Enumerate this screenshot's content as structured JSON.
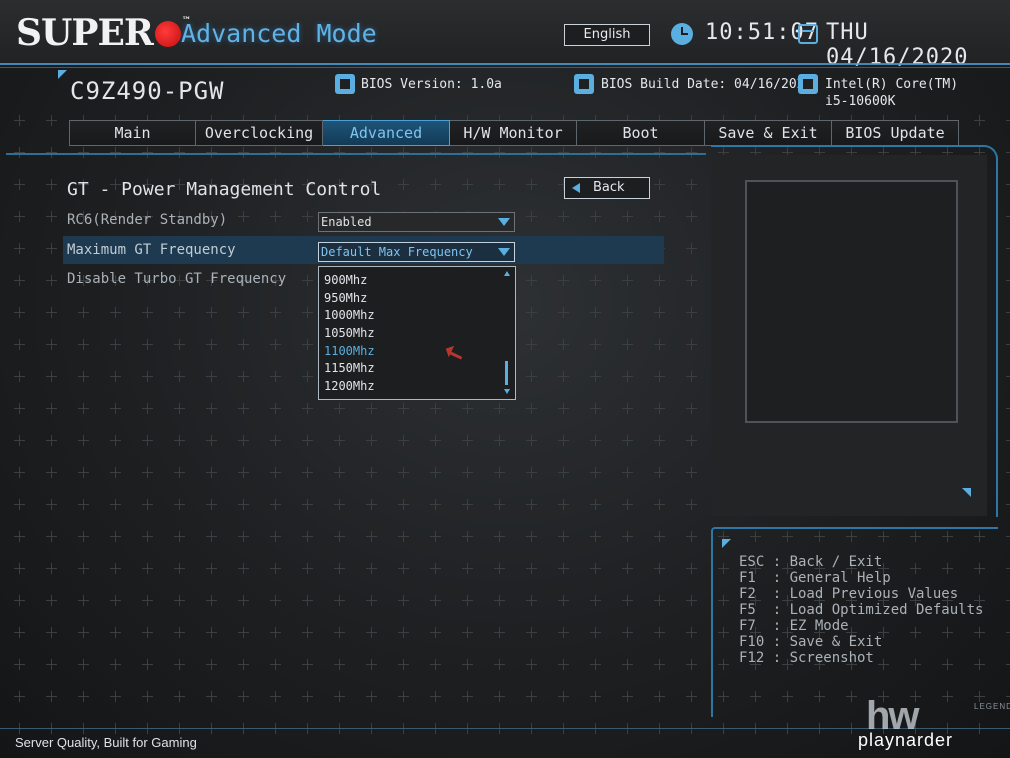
{
  "header": {
    "brand": "SUPER",
    "mode_title": "Advanced Mode",
    "language_button": "English",
    "time": "10:51:07",
    "date": "THU 04/16/2020"
  },
  "system_info": {
    "model": "C9Z490-PGW",
    "bios_version": "BIOS Version: 1.0a",
    "bios_build_date": "BIOS Build Date: 04/16/2020",
    "cpu_line1": "Intel(R) Core(TM)",
    "cpu_line2": "i5-10600K"
  },
  "tabs": [
    {
      "label": "Main",
      "active": false
    },
    {
      "label": "Overclocking",
      "active": false
    },
    {
      "label": "Advanced",
      "active": true
    },
    {
      "label": "H/W Monitor",
      "active": false
    },
    {
      "label": "Boot",
      "active": false
    },
    {
      "label": "Save & Exit",
      "active": false
    },
    {
      "label": "BIOS Update",
      "active": false
    }
  ],
  "page": {
    "title": "GT - Power Management Control",
    "back_button": "Back",
    "settings": [
      {
        "label": "RC6(Render Standby)",
        "value": "Enabled"
      },
      {
        "label": "Maximum GT Frequency",
        "value": "Default Max Frequency"
      },
      {
        "label": "Disable Turbo GT Frequency",
        "value": ""
      }
    ],
    "dropdown_options": [
      "900Mhz",
      "950Mhz",
      "1000Mhz",
      "1050Mhz",
      "1100Mhz",
      "1150Mhz",
      "1200Mhz"
    ],
    "selected_option": "1100Mhz"
  },
  "help": [
    "ESC : Back / Exit",
    "F1  : General Help",
    "F2  : Load Previous Values",
    "F5  : Load Optimized Defaults",
    "F7  : EZ Mode",
    "F10 : Save & Exit",
    "F12 : Screenshot"
  ],
  "footer": {
    "tagline": "Server Quality, Built for Gaming"
  },
  "watermark": {
    "big": "hw",
    "small": "playnarder",
    "legend": "LEGEND"
  },
  "colors": {
    "accent": "#5aaee0",
    "active_tab": "#1f5579",
    "logo_red": "#d51818"
  }
}
